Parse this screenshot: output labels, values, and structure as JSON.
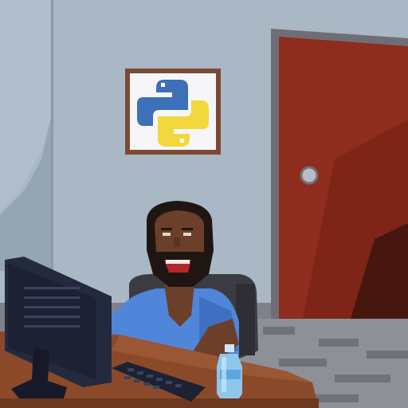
{
  "scene": {
    "style": "pixel-art",
    "description_text": "",
    "colors": {
      "wall": "#a9b8c4",
      "wall_shadow": "#8fa0ad",
      "door": "#8c2b1f",
      "door_frame": "#6f6f75",
      "floor": "#7c7f86",
      "desk": "#8a4a2a",
      "shirt": "#4f86d9",
      "skin": "#6b3f2a",
      "hair": "#1f1613",
      "chair": "#3a3a40",
      "monitor": "#20263a",
      "python_blue": "#3d70b8",
      "python_yellow": "#f2d83c"
    }
  },
  "items": [
    {
      "id": "python-poster",
      "icon": "python-logo"
    },
    {
      "id": "door",
      "icon": "door"
    },
    {
      "id": "door-knob",
      "icon": "knob"
    },
    {
      "id": "developer",
      "icon": "person"
    },
    {
      "id": "office-chair",
      "icon": "chair"
    },
    {
      "id": "monitor",
      "icon": "computer-monitor"
    },
    {
      "id": "keyboard",
      "icon": "keyboard"
    },
    {
      "id": "water-bottle",
      "icon": "bottle"
    },
    {
      "id": "desk",
      "icon": "desk"
    },
    {
      "id": "floor",
      "icon": "floor"
    }
  ]
}
